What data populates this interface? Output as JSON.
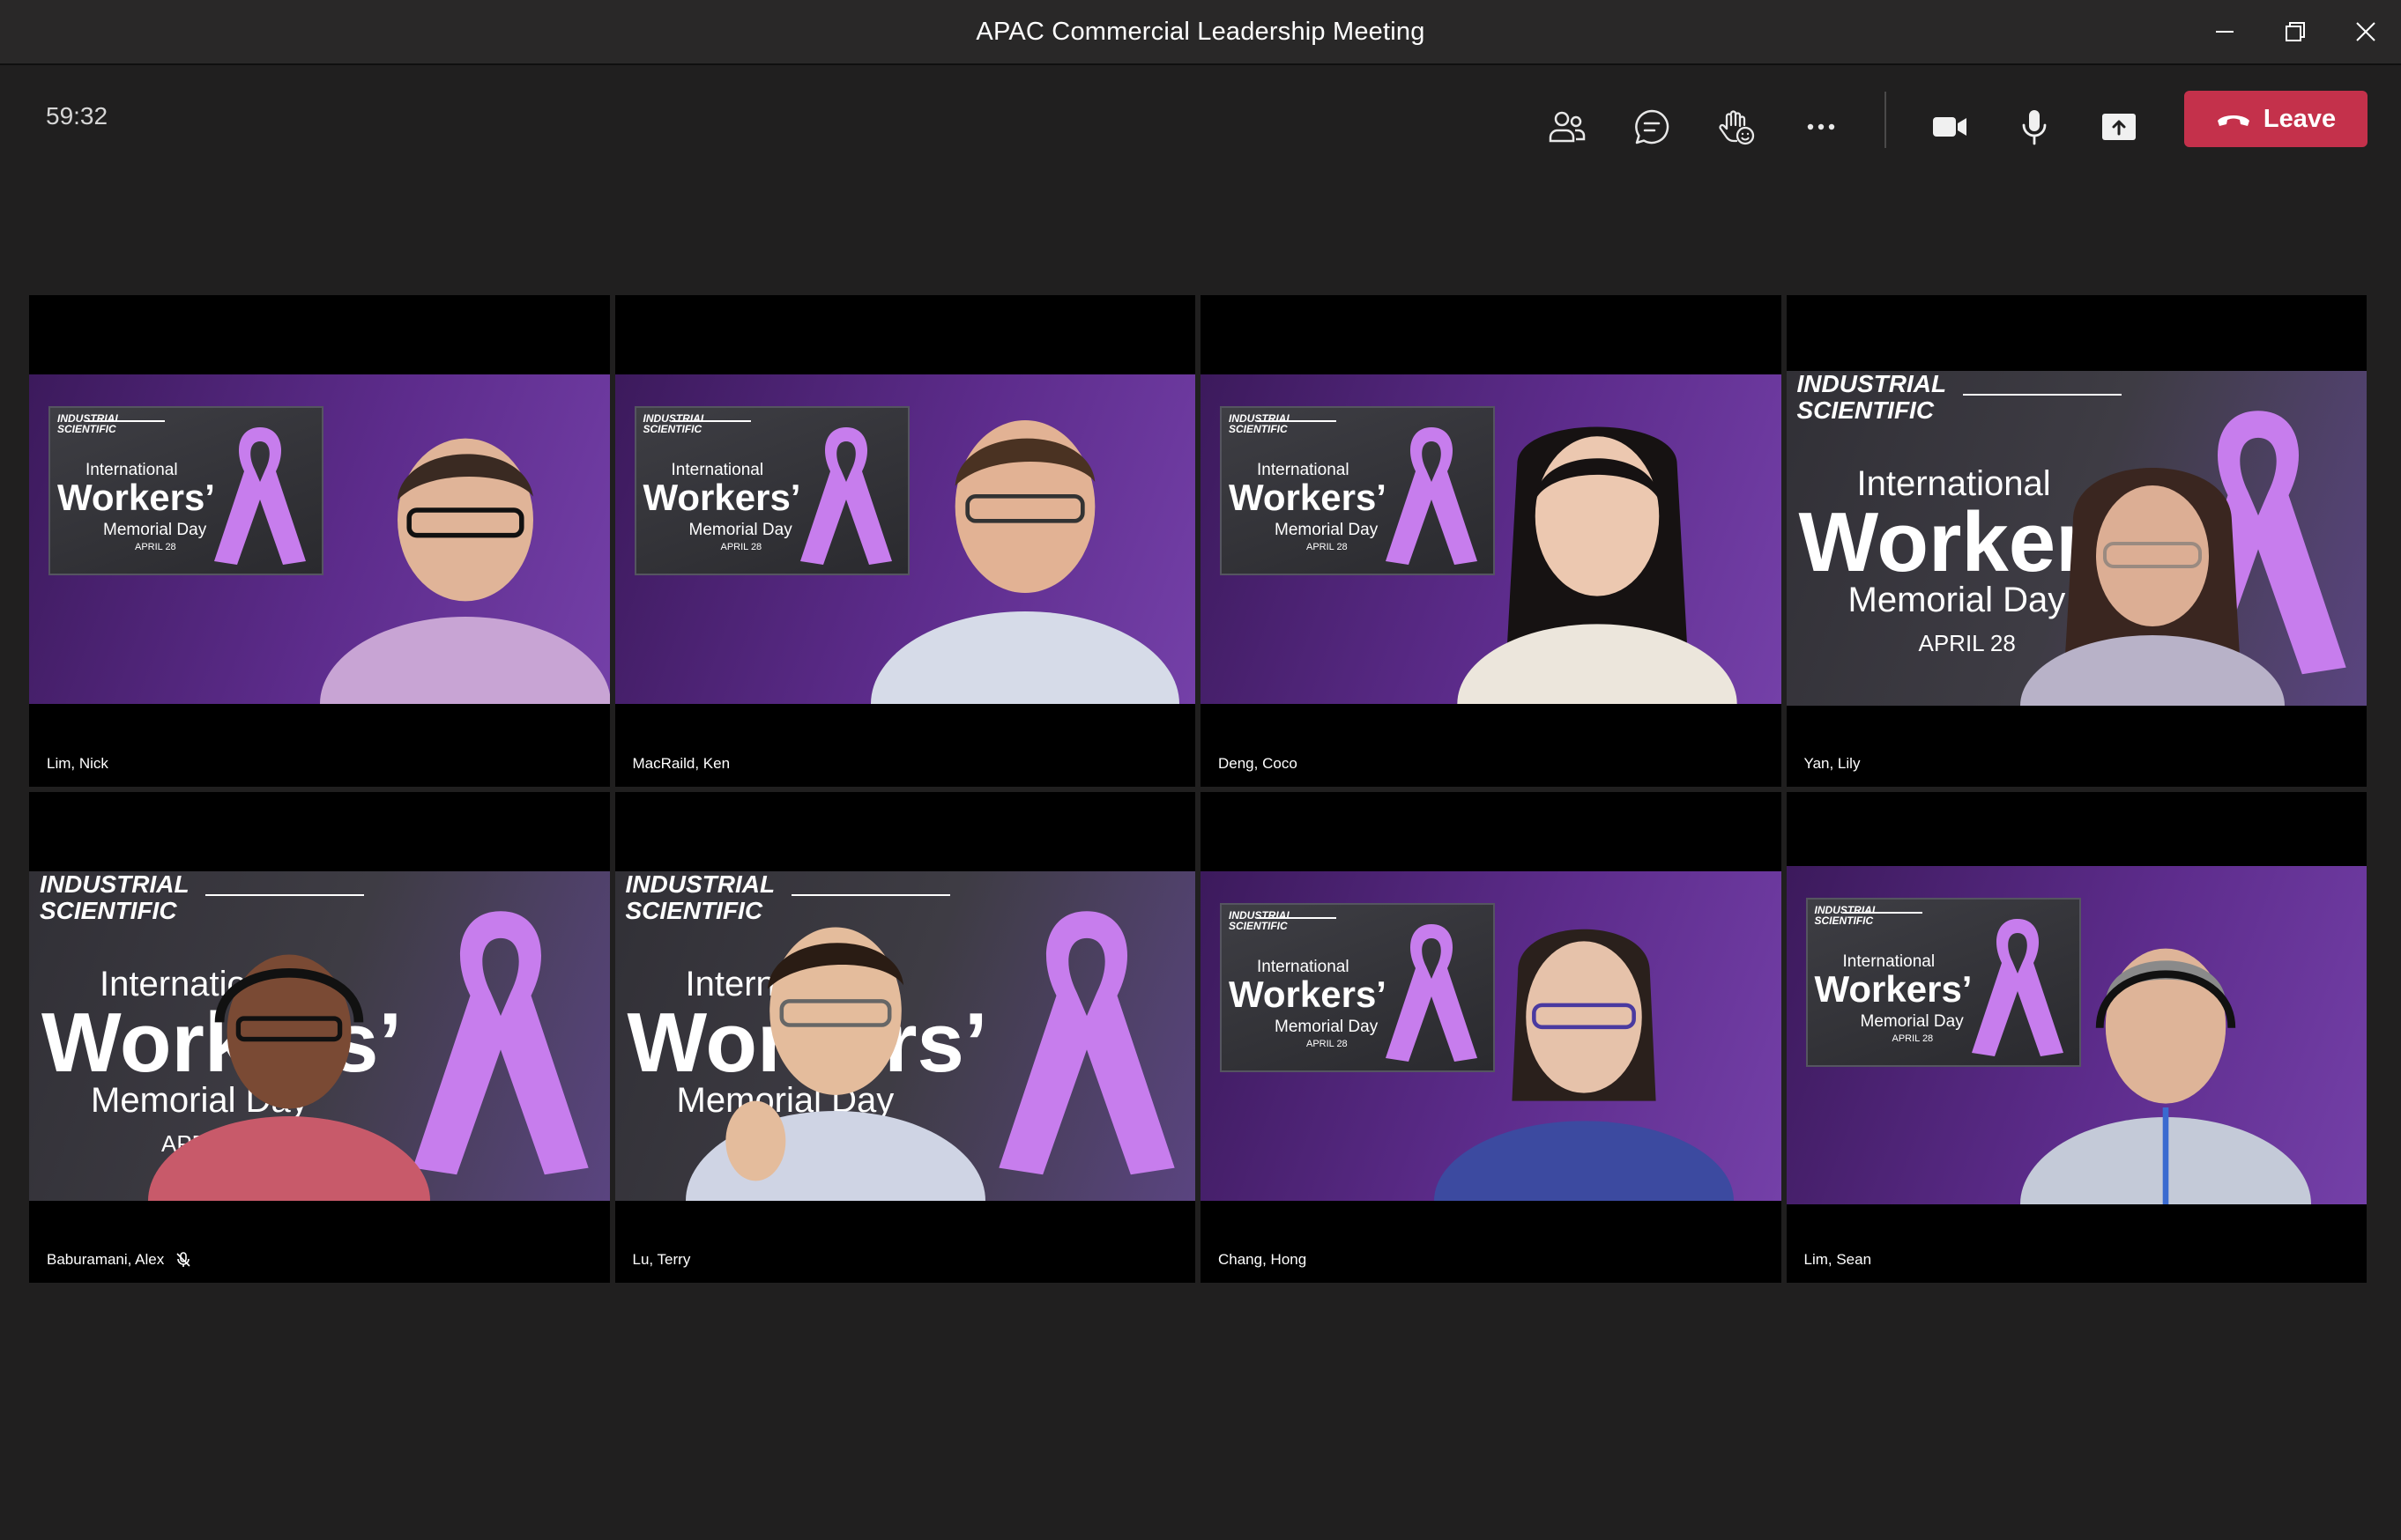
{
  "window": {
    "title": "APAC Commercial Leadership Meeting",
    "controls": [
      {
        "name": "minimize-button",
        "icon": "minimize-icon"
      },
      {
        "name": "restore-button",
        "icon": "restore-icon"
      },
      {
        "name": "close-button",
        "icon": "close-icon"
      }
    ]
  },
  "toolbar": {
    "timer": "59:32",
    "buttons": [
      {
        "name": "people-button",
        "icon": "people-icon"
      },
      {
        "name": "chat-button",
        "icon": "chat-icon"
      },
      {
        "name": "reactions-button",
        "icon": "raise-hand-icon"
      },
      {
        "name": "more-options-button",
        "icon": "more-icon"
      },
      {
        "name": "camera-button",
        "icon": "camera-icon"
      },
      {
        "name": "microphone-button",
        "icon": "microphone-icon"
      },
      {
        "name": "share-button",
        "icon": "share-screen-icon"
      }
    ],
    "leave_label": "Leave",
    "leave_color": "#c4314b"
  },
  "background_text": {
    "brand_line1": "INDUSTRIAL",
    "brand_line2": "SCIENTIFIC",
    "intl": "International",
    "workers": "Workers’",
    "memorial": "Memorial Day",
    "date": "APRIL 28"
  },
  "participants": [
    {
      "name": "Lim, Nick",
      "muted": false
    },
    {
      "name": "MacRaild, Ken",
      "muted": false
    },
    {
      "name": "Deng, Coco",
      "muted": false
    },
    {
      "name": "Yan, Lily",
      "muted": false
    },
    {
      "name": "Baburamani, Alex",
      "muted": true
    },
    {
      "name": "Lu, Terry",
      "muted": false
    },
    {
      "name": "Chang, Hong",
      "muted": false
    },
    {
      "name": "Lim, Sean",
      "muted": false
    }
  ],
  "colors": {
    "ribbon": "#c77ded",
    "background": "#201f1f",
    "titlebar": "#292828"
  }
}
